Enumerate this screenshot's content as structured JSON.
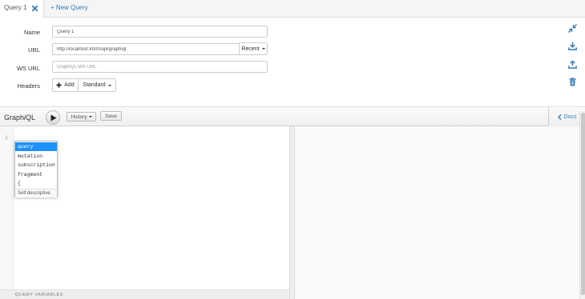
{
  "tabs": {
    "active_label": "Query 1",
    "new_query_label": "+ New Query"
  },
  "form": {
    "name_label": "Name",
    "name_value": "Query 1",
    "url_label": "URL",
    "url_value": "http://localhost:4000/api/graphiql",
    "recent_label": "Recent",
    "ws_url_label": "WS URL",
    "ws_url_placeholder": "GraphQL WS URL",
    "headers_label": "Headers",
    "add_label": "Add",
    "standard_label": "Standard"
  },
  "side_icons": [
    "collapse-icon",
    "download-icon",
    "upload-icon",
    "trash-icon"
  ],
  "graphiql": {
    "title_pre": "Graph",
    "title_i": "i",
    "title_post": "QL",
    "history_label": "History",
    "save_label": "Save",
    "docs_label": "Docs",
    "line_number": "1",
    "query_variables_label": "QUERY VARIABLES"
  },
  "autocomplete": {
    "items": [
      "query",
      "mutation",
      "subscription",
      "fragment",
      "{"
    ],
    "selected": "query",
    "description": "Self descriptive."
  },
  "colors": {
    "link": "#337ab7",
    "selection": "#1e90ff"
  }
}
